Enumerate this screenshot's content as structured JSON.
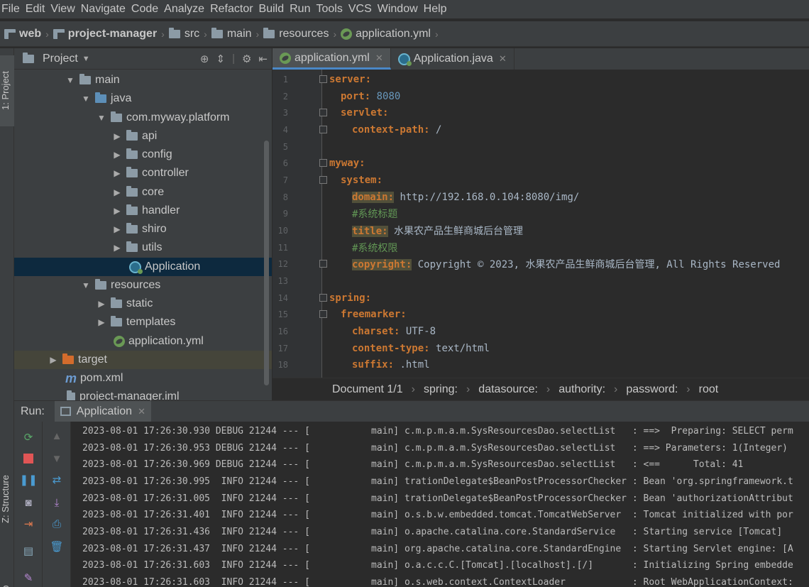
{
  "menu": [
    "File",
    "Edit",
    "View",
    "Navigate",
    "Code",
    "Analyze",
    "Refactor",
    "Build",
    "Run",
    "Tools",
    "VCS",
    "Window",
    "Help"
  ],
  "breadcrumb": [
    "web",
    "project-manager",
    "src",
    "main",
    "resources",
    "application.yml"
  ],
  "left_strip": {
    "project": "1: Project",
    "structure": "Z: Structure",
    "web": "Web"
  },
  "project_panel": {
    "title": "Project",
    "tree": [
      {
        "label": "main",
        "icon": "folder-icon"
      },
      {
        "label": "java",
        "icon": "folder-blue-icon"
      },
      {
        "label": "com.myway.platform",
        "icon": "package-icon"
      },
      {
        "label": "api",
        "icon": "package-icon"
      },
      {
        "label": "config",
        "icon": "package-icon"
      },
      {
        "label": "controller",
        "icon": "package-icon"
      },
      {
        "label": "core",
        "icon": "package-icon"
      },
      {
        "label": "handler",
        "icon": "package-icon"
      },
      {
        "label": "shiro",
        "icon": "package-icon"
      },
      {
        "label": "utils",
        "icon": "package-icon"
      },
      {
        "label": "Application",
        "icon": "spring-class-icon"
      },
      {
        "label": "resources",
        "icon": "resources-folder-icon"
      },
      {
        "label": "static",
        "icon": "folder-icon"
      },
      {
        "label": "templates",
        "icon": "folder-icon"
      },
      {
        "label": "application.yml",
        "icon": "yml-file-icon"
      },
      {
        "label": "target",
        "icon": "folder-orange-icon"
      },
      {
        "label": "pom.xml",
        "icon": "maven-icon"
      },
      {
        "label": "project-manager.iml",
        "icon": "iml-file-icon"
      }
    ]
  },
  "editor_tabs": [
    {
      "label": "application.yml",
      "active": true
    },
    {
      "label": "Application.java",
      "active": false
    }
  ],
  "code": {
    "line_numbers": [
      "1",
      "2",
      "3",
      "4",
      "5",
      "6",
      "7",
      "8",
      "9",
      "10",
      "11",
      "12",
      "13",
      "14",
      "15",
      "16",
      "17",
      "18"
    ],
    "l1_key": "server:",
    "l2_key": "port:",
    "l2_val": "8080",
    "l3_key": "servlet:",
    "l4_key": "context-path:",
    "l4_val": "/",
    "l6_key": "myway:",
    "l7_key": "system:",
    "l8_key": "domain:",
    "l8_val": "http://192.168.0.104:8080/img/",
    "l9_cmt": "#系统标题",
    "l10_key": "title:",
    "l10_val": "水果农产品生鲜商城后台管理",
    "l11_cmt": "#系统权限",
    "l12_key": "copyright:",
    "l12_val": "Copyright © 2023, 水果农产品生鲜商城后台管理, All Rights Reserved",
    "l14_key": "spring:",
    "l15_key": "freemarker:",
    "l16_key": "charset:",
    "l16_val": "UTF-8",
    "l17_key": "content-type:",
    "l17_val": "text/html",
    "l18_key": "suffix:",
    "l18_val": ".html"
  },
  "editor_breadcrumb": [
    "Document 1/1",
    "spring:",
    "datasource:",
    "authority:",
    "password:",
    "root"
  ],
  "run": {
    "label": "Run:",
    "tab": "Application",
    "logs": [
      "2023-08-01 17:26:30.930 DEBUG 21244 --- [           main] c.m.p.m.a.m.SysResourcesDao.selectList   : ==>  Preparing: SELECT perm",
      "2023-08-01 17:26:30.953 DEBUG 21244 --- [           main] c.m.p.m.a.m.SysResourcesDao.selectList   : ==> Parameters: 1(Integer)",
      "2023-08-01 17:26:30.969 DEBUG 21244 --- [           main] c.m.p.m.a.m.SysResourcesDao.selectList   : <==      Total: 41",
      "2023-08-01 17:26:30.995  INFO 21244 --- [           main] trationDelegate$BeanPostProcessorChecker : Bean 'org.springframework.t",
      "2023-08-01 17:26:31.005  INFO 21244 --- [           main] trationDelegate$BeanPostProcessorChecker : Bean 'authorizationAttribut",
      "2023-08-01 17:26:31.401  INFO 21244 --- [           main] o.s.b.w.embedded.tomcat.TomcatWebServer  : Tomcat initialized with por",
      "2023-08-01 17:26:31.436  INFO 21244 --- [           main] o.apache.catalina.core.StandardService   : Starting service [Tomcat]",
      "2023-08-01 17:26:31.437  INFO 21244 --- [           main] org.apache.catalina.core.StandardEngine  : Starting Servlet engine: [A",
      "2023-08-01 17:26:31.603  INFO 21244 --- [           main] o.a.c.c.C.[Tomcat].[localhost].[/]       : Initializing Spring embedde",
      "2023-08-01 17:26:31.603  INFO 21244 --- [           main] o.s.web.context.ContextLoader            : Root WebApplicationContext:"
    ]
  },
  "colors": {
    "keyword": "#cc7832",
    "number": "#6897bb",
    "comment": "#629755",
    "selection": "#0d293e",
    "tab_underline": "#4a88c7"
  }
}
